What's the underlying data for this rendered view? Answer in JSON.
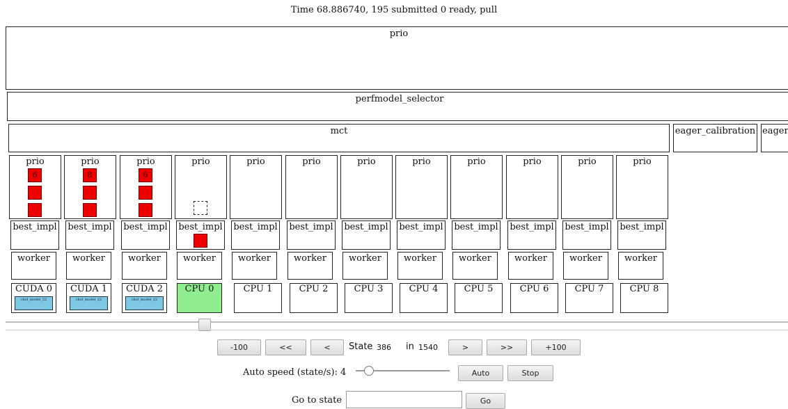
{
  "header": {
    "status": "Time 68.886740, 195 submitted 0 ready, pull"
  },
  "tree": {
    "root_label": "prio",
    "selector_label": "perfmodel_selector",
    "mct_label": "mct",
    "eager_calibration_label": "eager_calibration",
    "eager_cut_label": "eager",
    "prio_label": "prio",
    "best_impl_label": "best_impl",
    "worker_label": "worker"
  },
  "columns": [
    {
      "device": "CUDA 0",
      "prio_tasks": [
        "6",
        "",
        ""
      ],
      "prio_dashed": false,
      "best_impl_task": false,
      "device_active": false,
      "running_task": "chol_model_22"
    },
    {
      "device": "CUDA 1",
      "prio_tasks": [
        "8",
        "",
        ""
      ],
      "prio_dashed": false,
      "best_impl_task": false,
      "device_active": false,
      "running_task": "chol_model_22"
    },
    {
      "device": "CUDA 2",
      "prio_tasks": [
        "6",
        "",
        ""
      ],
      "prio_dashed": false,
      "best_impl_task": false,
      "device_active": false,
      "running_task": "chol_model_22"
    },
    {
      "device": "CPU 0",
      "prio_tasks": [],
      "prio_dashed": true,
      "best_impl_task": true,
      "device_active": true,
      "running_task": ""
    },
    {
      "device": "CPU 1",
      "prio_tasks": [],
      "prio_dashed": false,
      "best_impl_task": false,
      "device_active": false,
      "running_task": ""
    },
    {
      "device": "CPU 2",
      "prio_tasks": [],
      "prio_dashed": false,
      "best_impl_task": false,
      "device_active": false,
      "running_task": ""
    },
    {
      "device": "CPU 3",
      "prio_tasks": [],
      "prio_dashed": false,
      "best_impl_task": false,
      "device_active": false,
      "running_task": ""
    },
    {
      "device": "CPU 4",
      "prio_tasks": [],
      "prio_dashed": false,
      "best_impl_task": false,
      "device_active": false,
      "running_task": ""
    },
    {
      "device": "CPU 5",
      "prio_tasks": [],
      "prio_dashed": false,
      "best_impl_task": false,
      "device_active": false,
      "running_task": ""
    },
    {
      "device": "CPU 6",
      "prio_tasks": [],
      "prio_dashed": false,
      "best_impl_task": false,
      "device_active": false,
      "running_task": ""
    },
    {
      "device": "CPU 7",
      "prio_tasks": [],
      "prio_dashed": false,
      "best_impl_task": false,
      "device_active": false,
      "running_task": ""
    },
    {
      "device": "CPU 8",
      "prio_tasks": [],
      "prio_dashed": false,
      "best_impl_task": false,
      "device_active": false,
      "running_task": ""
    }
  ],
  "colors": {
    "task": "#ee0000",
    "active_device": "#90ee90",
    "running_task": "#7ec8e3"
  },
  "controls": {
    "state_slider_fraction": 0.2507,
    "minus100": "-100",
    "rewind": "<<",
    "back": "<",
    "state_label": "State",
    "state_value": "386",
    "in_label": "in",
    "total_value": "1540",
    "forward": ">",
    "fast_forward": ">>",
    "plus100": "+100",
    "auto_speed_label": "Auto speed (state/s): 4",
    "speed_slider_fraction": 0.1,
    "auto": "Auto",
    "stop": "Stop",
    "goto_label": "Go to state",
    "goto_value": "",
    "go": "Go"
  }
}
